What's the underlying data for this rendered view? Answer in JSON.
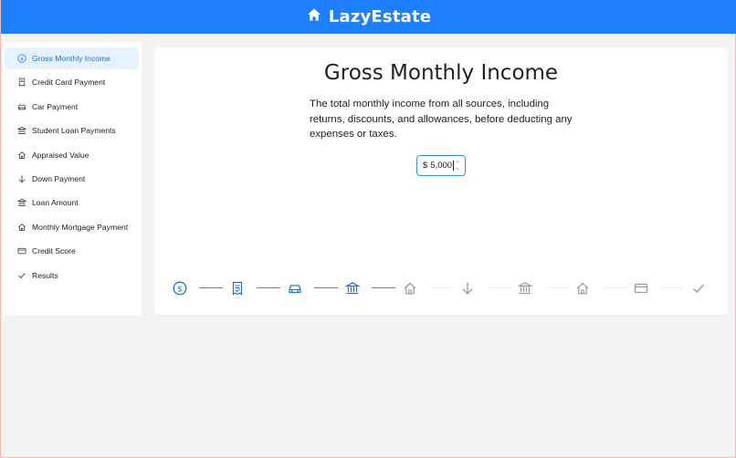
{
  "app": {
    "title": "LazyEstate"
  },
  "sidebar": {
    "items": [
      {
        "label": "Gross Monthly Income",
        "icon": "dollar-circle-icon",
        "active": true
      },
      {
        "label": "Credit Card Payment",
        "icon": "receipt-icon"
      },
      {
        "label": "Car Payment",
        "icon": "car-icon"
      },
      {
        "label": "Student Loan Payments",
        "icon": "bank-icon"
      },
      {
        "label": "Appraised Value",
        "icon": "home-icon"
      },
      {
        "label": "Down Payment",
        "icon": "arrow-down-icon"
      },
      {
        "label": "Loan Amount",
        "icon": "bank-icon"
      },
      {
        "label": "Monthly Mortgage Payment",
        "icon": "home-icon"
      },
      {
        "label": "Credit Score",
        "icon": "credit-card-icon"
      },
      {
        "label": "Results",
        "icon": "check-icon"
      }
    ]
  },
  "main": {
    "title": "Gross Monthly Income",
    "description": "The total monthly income from all sources, including returns, discounts, and allowances, before deducting any expenses or taxes.",
    "input": {
      "prefix": "$",
      "value": "5,000"
    }
  },
  "stepper": {
    "current_step": 1,
    "total_steps": 10,
    "completed_or_active": 4
  },
  "colors": {
    "brand": "#1e80ff",
    "accent": "#1e74d6",
    "inactive": "#9a9a9a"
  }
}
